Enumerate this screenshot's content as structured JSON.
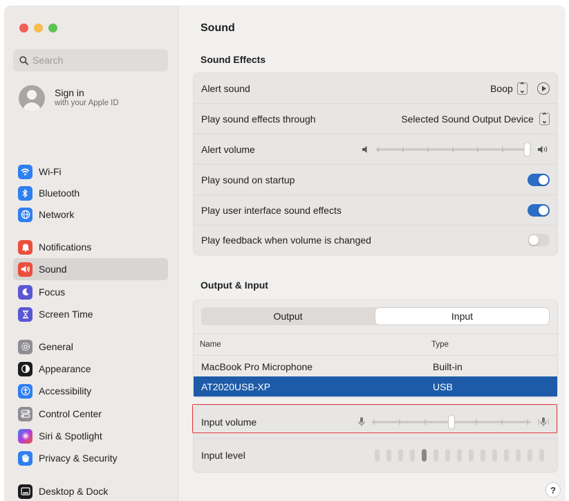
{
  "sidebar": {
    "search_placeholder": "Search",
    "signin": {
      "title": "Sign in",
      "subtitle": "with your Apple ID"
    },
    "items": [
      {
        "label": "Wi-Fi",
        "icon": "wifi-icon",
        "color": "#2f7ff0"
      },
      {
        "label": "Bluetooth",
        "icon": "bluetooth-icon",
        "color": "#2f7ff0"
      },
      {
        "label": "Network",
        "icon": "globe-icon",
        "color": "#2f7ff0"
      },
      {
        "label": "Notifications",
        "icon": "bell-icon",
        "color": "#eb4e3d"
      },
      {
        "label": "Sound",
        "icon": "speaker-icon",
        "color": "#eb4e3d"
      },
      {
        "label": "Focus",
        "icon": "moon-icon",
        "color": "#5b57d4"
      },
      {
        "label": "Screen Time",
        "icon": "hourglass-icon",
        "color": "#5b57d4"
      },
      {
        "label": "General",
        "icon": "gear-icon",
        "color": "#8e8e93"
      },
      {
        "label": "Appearance",
        "icon": "appearance-icon",
        "color": "#1c1c1e"
      },
      {
        "label": "Accessibility",
        "icon": "accessibility-icon",
        "color": "#2f7ff0"
      },
      {
        "label": "Control Center",
        "icon": "control-center-icon",
        "color": "#8e8e93"
      },
      {
        "label": "Siri & Spotlight",
        "icon": "siri-icon",
        "color": "#3c2a6e"
      },
      {
        "label": "Privacy & Security",
        "icon": "hand-icon",
        "color": "#2f7ff0"
      },
      {
        "label": "Desktop & Dock",
        "icon": "dock-icon",
        "color": "#1c1c1e"
      }
    ]
  },
  "main": {
    "title": "Sound",
    "sound_effects": {
      "title": "Sound Effects",
      "alert_sound_label": "Alert sound",
      "alert_sound_value": "Boop",
      "play_through_label": "Play sound effects through",
      "play_through_value": "Selected Sound Output Device",
      "alert_volume_label": "Alert volume",
      "alert_volume_level": 1.0,
      "startup_label": "Play sound on startup",
      "startup_on": true,
      "ui_sounds_label": "Play user interface sound effects",
      "ui_sounds_on": true,
      "feedback_label": "Play feedback when volume is changed",
      "feedback_on": false
    },
    "output_input": {
      "title": "Output & Input",
      "tabs": [
        "Output",
        "Input"
      ],
      "selected_tab": "Input",
      "columns": [
        "Name",
        "Type"
      ],
      "devices": [
        {
          "name": "MacBook Pro Microphone",
          "type": "Built-in"
        },
        {
          "name": "AT2020USB-XP",
          "type": "USB"
        }
      ],
      "selected_device": "AT2020USB-XP",
      "input_volume_label": "Input volume",
      "input_volume_level": 0.5,
      "input_level_label": "Input level",
      "input_level_segments": 15,
      "input_level_active_index": 4
    },
    "help_label": "?"
  },
  "colors": {
    "accent": "#2b6ec4",
    "selection": "#1d5ba8",
    "highlight": "#e0363a"
  }
}
